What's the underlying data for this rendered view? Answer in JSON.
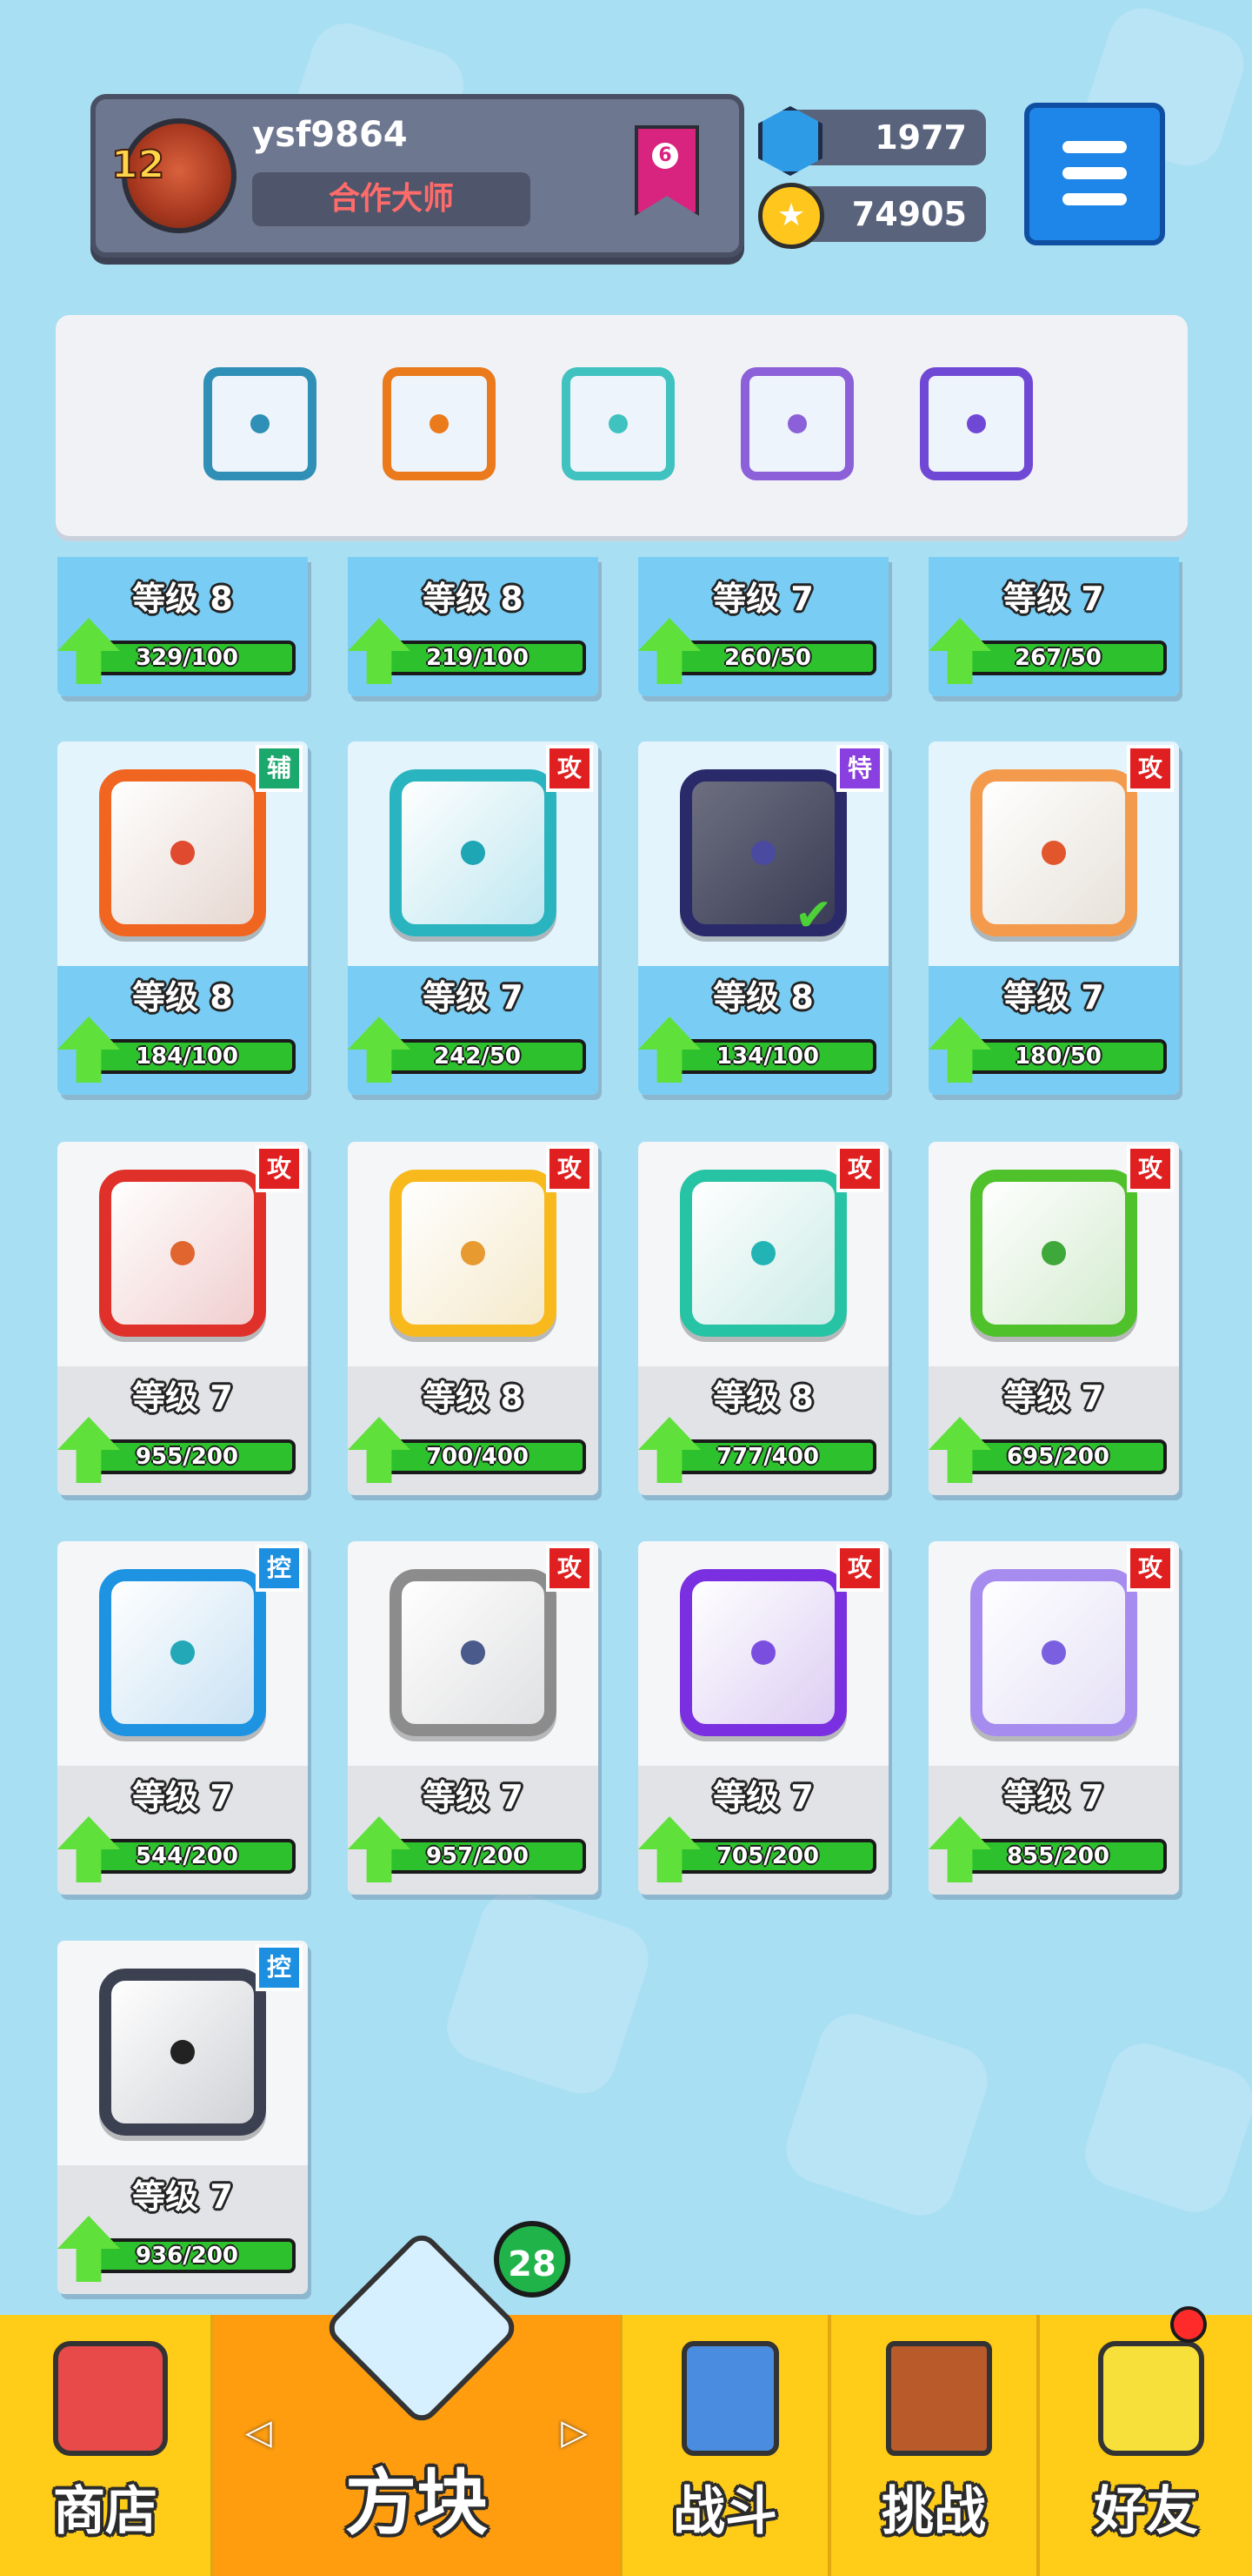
{
  "profile": {
    "username": "ysf9864",
    "avatar_level": "12",
    "title": "合作大师",
    "rank": "6"
  },
  "currency": {
    "gems": "1977",
    "coins": "74905"
  },
  "deck": {
    "slots": [
      {
        "icon": "blue-vortex-dragon-icon",
        "color": "#2f8fb6"
      },
      {
        "icon": "orange-sun-dragon-icon",
        "color": "#ea7a1c"
      },
      {
        "icon": "cyan-hands-icon",
        "color": "#3fc2c0"
      },
      {
        "icon": "purple-crack-icon",
        "color": "#8c60d8"
      },
      {
        "icon": "violet-swirl-dragon-icon",
        "color": "#7048d6"
      }
    ]
  },
  "cards": [
    {
      "level": "等级 8",
      "progress": "329/100",
      "collected": true
    },
    {
      "level": "等级 8",
      "progress": "219/100",
      "collected": true
    },
    {
      "level": "等级 7",
      "progress": "260/50",
      "collected": true
    },
    {
      "level": "等级 7",
      "progress": "267/50",
      "collected": true
    },
    {
      "level": "等级 8",
      "progress": "184/100",
      "badge": "辅",
      "badge_color": "#1aa86c",
      "icon": "sword-icon",
      "frame": "#f0651f",
      "dot": "#e04a2f",
      "collected": true
    },
    {
      "level": "等级 7",
      "progress": "242/50",
      "badge": "攻",
      "badge_color": "#e02020",
      "icon": "splash-icon",
      "frame": "#29b4bf",
      "dot": "#1fa6b4",
      "collected": true
    },
    {
      "level": "等级 8",
      "progress": "134/100",
      "badge": "特",
      "badge_color": "#8a3fe0",
      "icon": "hands-icon",
      "frame": "#2a2a6a",
      "dot": "#4a4aa0",
      "collected": true,
      "equipped": "✔"
    },
    {
      "level": "等级 7",
      "progress": "180/50",
      "badge": "攻",
      "badge_color": "#e02020",
      "icon": "bow-icon",
      "frame": "#f49a4c",
      "dot": "#e2562c",
      "collected": true
    },
    {
      "level": "等级 7",
      "progress": "955/200",
      "badge": "攻",
      "badge_color": "#e02020",
      "icon": "fire-icon",
      "frame": "#e0302a",
      "dot": "#e0652f",
      "collected": false
    },
    {
      "level": "等级 8",
      "progress": "700/400",
      "badge": "攻",
      "badge_color": "#e02020",
      "icon": "electric-icon",
      "frame": "#f7b91c",
      "dot": "#e69a30",
      "collected": false
    },
    {
      "level": "等级 8",
      "progress": "777/400",
      "badge": "攻",
      "badge_color": "#e02020",
      "icon": "wind-icon",
      "frame": "#26c3a4",
      "dot": "#22b4b4",
      "collected": false
    },
    {
      "level": "等级 7",
      "progress": "695/200",
      "badge": "攻",
      "badge_color": "#e02020",
      "icon": "poison-icon",
      "frame": "#4fc12b",
      "dot": "#3fa83a",
      "collected": false
    },
    {
      "level": "等级 7",
      "progress": "544/200",
      "badge": "控",
      "badge_color": "#1c8fe0",
      "icon": "ice-icon",
      "frame": "#1d93e2",
      "dot": "#23a8b8",
      "collected": false
    },
    {
      "level": "等级 7",
      "progress": "957/200",
      "badge": "攻",
      "badge_color": "#e02020",
      "icon": "gear-icon",
      "frame": "#8c8c8c",
      "dot": "#4a5a8a",
      "collected": false
    },
    {
      "level": "等级 7",
      "progress": "705/200",
      "badge": "攻",
      "badge_color": "#e02020",
      "icon": "arrows-cycle-icon",
      "frame": "#7a2fe0",
      "dot": "#7a4fe0",
      "collected": false
    },
    {
      "level": "等级 7",
      "progress": "855/200",
      "badge": "攻",
      "badge_color": "#e02020",
      "icon": "question-marks-icon",
      "frame": "#a78cf0",
      "dot": "#7a60e0",
      "collected": false
    },
    {
      "level": "等级 7",
      "progress": "936/200",
      "badge": "控",
      "badge_color": "#1c8fe0",
      "icon": "padlock-icon",
      "frame": "#3b4150",
      "dot": "#222",
      "collected": false
    }
  ],
  "nav": {
    "shop": "商店",
    "blocks": "方块",
    "battle": "战斗",
    "challenge": "挑战",
    "friends": "好友",
    "blocks_badge": "28",
    "arrow_left": "◁",
    "arrow_right": "▷"
  },
  "colors": {
    "background": "#a9dff3",
    "nav_yellow": "#ffcc18",
    "nav_active": "#ff9d0f"
  }
}
